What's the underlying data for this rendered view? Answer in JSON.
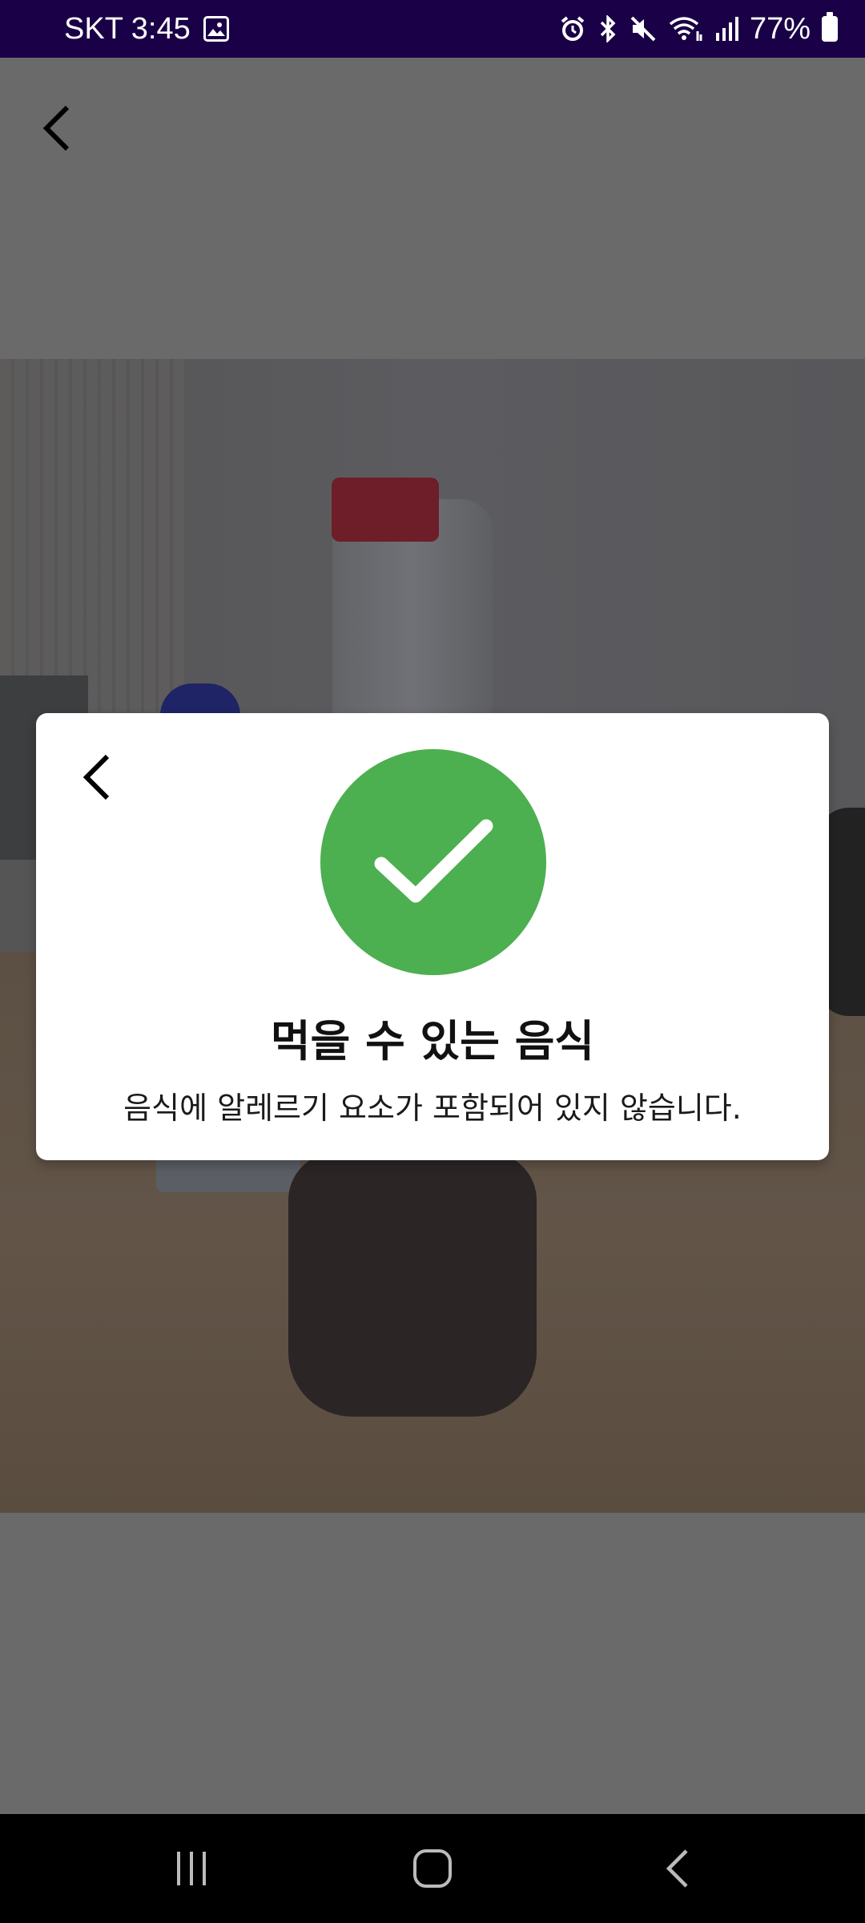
{
  "status_bar": {
    "carrier_time": "SKT 3:45",
    "battery_percent": "77%",
    "icons": [
      "gallery-icon",
      "alarm-icon",
      "bluetooth-icon",
      "mute-icon",
      "wifi-icon",
      "signal-icon",
      "battery-icon"
    ]
  },
  "dialog": {
    "title": "먹을 수 있는 음식",
    "message": "음식에 알레르기 요소가 포함되어 있지 않습니다.",
    "status_color": "#4caf50",
    "icon": "check-icon"
  },
  "nav_bar": {
    "buttons": [
      "recent-apps-icon",
      "home-icon",
      "back-icon"
    ]
  },
  "colors": {
    "status_bar_bg": "#1a0046",
    "overlay_bg": "#6a6a6a",
    "success": "#4caf50"
  }
}
